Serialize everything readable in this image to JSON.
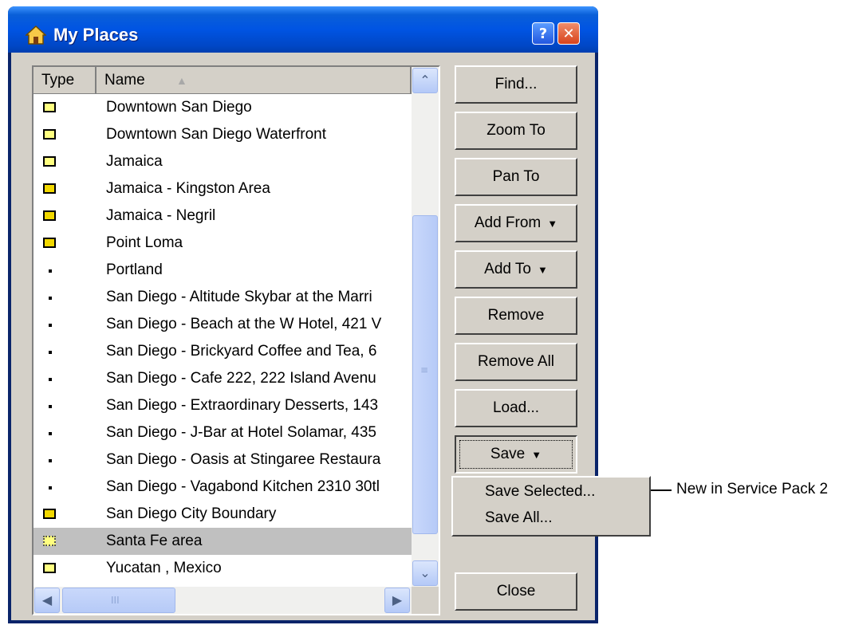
{
  "window": {
    "title": "My Places",
    "help_label": "?",
    "close_label": "✕"
  },
  "list": {
    "columns": [
      "Type",
      "Name"
    ],
    "sort_indicator": "▲",
    "rows": [
      {
        "icon": "rect",
        "name": "Downtown San Diego"
      },
      {
        "icon": "rect",
        "name": "Downtown San Diego Waterfront"
      },
      {
        "icon": "rect",
        "name": "Jamaica"
      },
      {
        "icon": "envelope",
        "name": "Jamaica - Kingston Area"
      },
      {
        "icon": "envelope",
        "name": "Jamaica - Negril"
      },
      {
        "icon": "envelope",
        "name": "Point Loma"
      },
      {
        "icon": "dot",
        "name": "Portland"
      },
      {
        "icon": "dot",
        "name": "San Diego - Altitude Skybar at the Marri"
      },
      {
        "icon": "dot",
        "name": "San Diego - Beach at the W Hotel, 421 V"
      },
      {
        "icon": "dot",
        "name": "San Diego - Brickyard Coffee and Tea, 6"
      },
      {
        "icon": "dot",
        "name": "San Diego - Cafe 222, 222 Island Avenu"
      },
      {
        "icon": "dot",
        "name": "San Diego - Extraordinary Desserts, 143"
      },
      {
        "icon": "dot",
        "name": "San Diego - J-Bar at Hotel Solamar, 435"
      },
      {
        "icon": "dot",
        "name": "San Diego - Oasis at Stingaree Restaura"
      },
      {
        "icon": "dot",
        "name": "San Diego - Vagabond Kitchen 2310 30tl"
      },
      {
        "icon": "envelope",
        "name": "San Diego City Boundary"
      },
      {
        "icon": "dashed",
        "name": "Santa Fe area",
        "selected": true
      },
      {
        "icon": "rect",
        "name": "Yucatan , Mexico"
      }
    ]
  },
  "buttons": {
    "find": "Find...",
    "zoom_to": "Zoom To",
    "pan_to": "Pan To",
    "add_from": "Add From",
    "add_to": "Add To",
    "remove": "Remove",
    "remove_all": "Remove All",
    "load": "Load...",
    "save": "Save",
    "close": "Close",
    "dropdown_arrow": "▼"
  },
  "save_menu": {
    "items": [
      "Save Selected...",
      "Save All..."
    ]
  },
  "callout": {
    "text": "New in Service Pack 2"
  },
  "scrollbar": {
    "up": "⌃",
    "down": "⌄",
    "left": "◀",
    "right": "▶",
    "grip_v": "≡",
    "grip_h": "III"
  },
  "colors": {
    "titlebar": "#0054e3",
    "dialog_face": "#d4d0c8",
    "selection": "#c0c0c0",
    "close_button": "#d8431c"
  }
}
